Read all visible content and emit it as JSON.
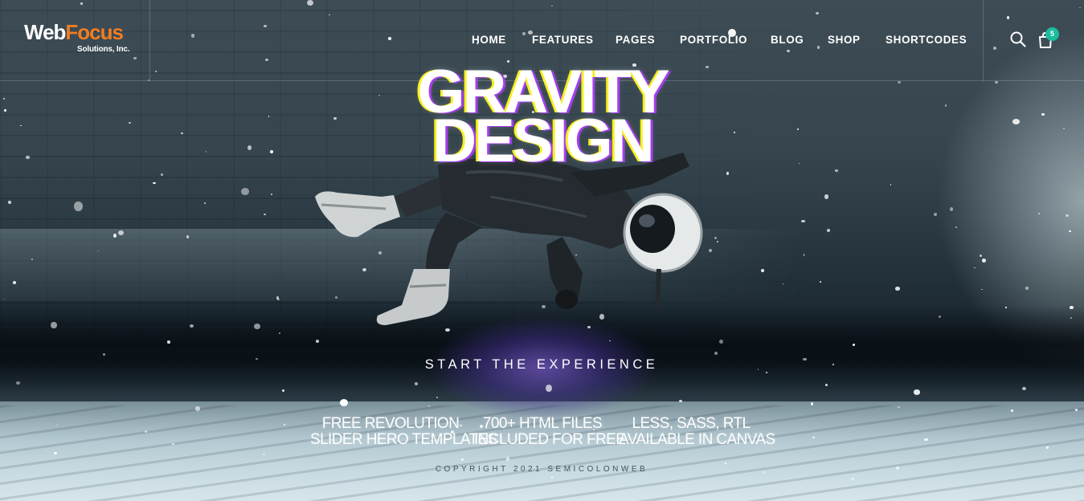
{
  "brand": {
    "name_part1": "Web",
    "name_part2": "Focus",
    "tagline": "Solutions, Inc.",
    "accent_color": "#f07d22"
  },
  "nav": {
    "items": [
      {
        "label": "HOME"
      },
      {
        "label": "FEATURES"
      },
      {
        "label": "PAGES"
      },
      {
        "label": "PORTFOLIO"
      },
      {
        "label": "BLOG"
      },
      {
        "label": "SHOP"
      },
      {
        "label": "SHORTCODES"
      }
    ]
  },
  "header_actions": {
    "search_icon": "search-icon",
    "cart_icon": "shopping-bag-icon",
    "cart_count": "5",
    "badge_color": "#1abc9c"
  },
  "hero": {
    "title_line1": "GRAVITY",
    "title_line2": "DESIGN",
    "cta_label": "START THE EXPERIENCE"
  },
  "features": [
    {
      "line1": "FREE REVOLUTION",
      "line2": "SLIDER HERO TEMPLATES"
    },
    {
      "line1": "700+ HTML FILES",
      "line2": "INCLUDED FOR FREE"
    },
    {
      "line1": "LESS, SASS, RTL",
      "line2": "AVAILABLE IN CANVAS"
    }
  ],
  "footer": {
    "copyright": "COPYRIGHT 2021 SEMICOLONWEB"
  }
}
